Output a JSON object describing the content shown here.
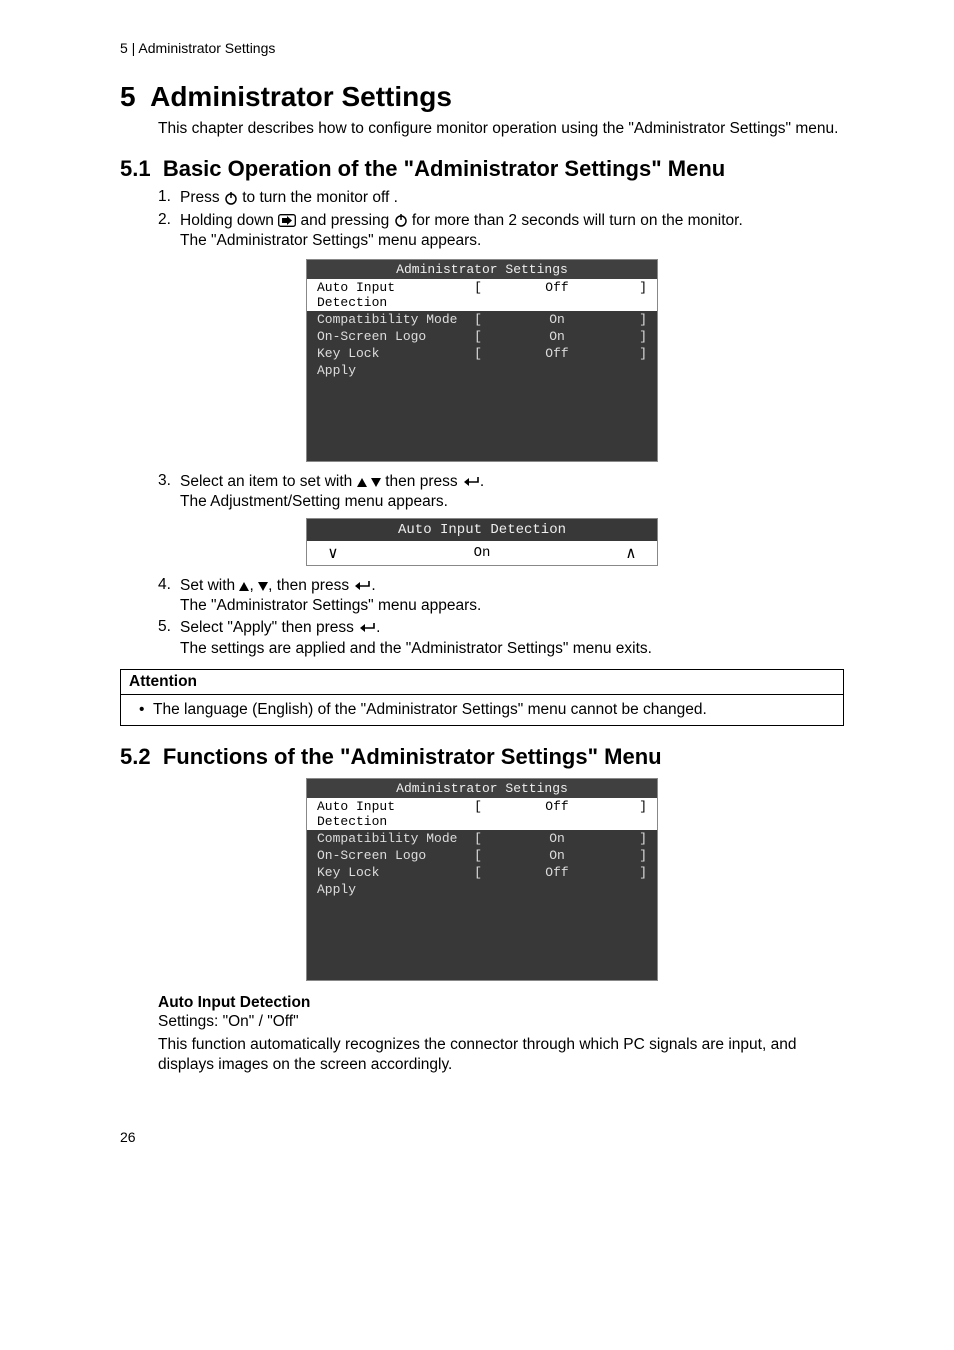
{
  "page_header": "5  |  Administrator Settings",
  "chapter_num": "5",
  "chapter_title": "Administrator Settings",
  "chapter_intro": "This chapter describes how to configure monitor operation using the \"Administrator Settings\" menu.",
  "section1": {
    "num": "5.1",
    "title": "Basic Operation of the \"Administrator Settings\" Menu",
    "steps": [
      {
        "num": "1.",
        "line1_a": "Press ",
        "line1_b": " to turn the monitor off ."
      },
      {
        "num": "2.",
        "line1_a": "Holding down ",
        "line1_b": " and pressing ",
        "line1_c": " for more than 2 seconds will turn on the monitor.",
        "line2": "The \"Administrator Settings\" menu appears."
      },
      {
        "num": "3.",
        "line1_a": "Select an item to set with ",
        "line1_b": " then press ",
        "line1_c": ".",
        "line2": "The Adjustment/Setting menu appears."
      },
      {
        "num": "4.",
        "line1_a": "Set with ",
        "line1_b": ", then press ",
        "line1_c": ".",
        "line2": "The \"Administrator Settings\" menu appears."
      },
      {
        "num": "5.",
        "line1_a": "Select \"Apply\" then press ",
        "line1_b": ".",
        "line2": "The settings are applied and the \"Administrator Settings\" menu exits."
      }
    ]
  },
  "admin_menu": {
    "title": "Administrator Settings",
    "rows": [
      {
        "label": "Auto Input Detection",
        "l": "[",
        "val": "Off",
        "r": "]",
        "selected": true
      },
      {
        "label": "Compatibility Mode",
        "l": "[",
        "val": "On",
        "r": "]",
        "selected": false
      },
      {
        "label": "On-Screen Logo",
        "l": "[",
        "val": "On",
        "r": "]",
        "selected": false
      },
      {
        "label": "Key Lock",
        "l": "[",
        "val": "Off",
        "r": "]",
        "selected": false
      },
      {
        "label": "Apply",
        "l": "",
        "val": "",
        "r": "",
        "selected": false
      }
    ]
  },
  "adj_menu": {
    "title": "Auto Input Detection",
    "val": "On"
  },
  "attention": {
    "head": "Attention",
    "bullet": "The language (English) of the \"Administrator Settings\" menu cannot be changed."
  },
  "section2": {
    "num": "5.2",
    "title": "Functions of the \"Administrator Settings\" Menu",
    "item_title": "Auto Input Detection",
    "settings_line": "Settings: \"On\" / \"Off\"",
    "desc": "This function automatically recognizes the connector through which PC signals are input, and displays images on the screen accordingly."
  },
  "page_number": "26"
}
